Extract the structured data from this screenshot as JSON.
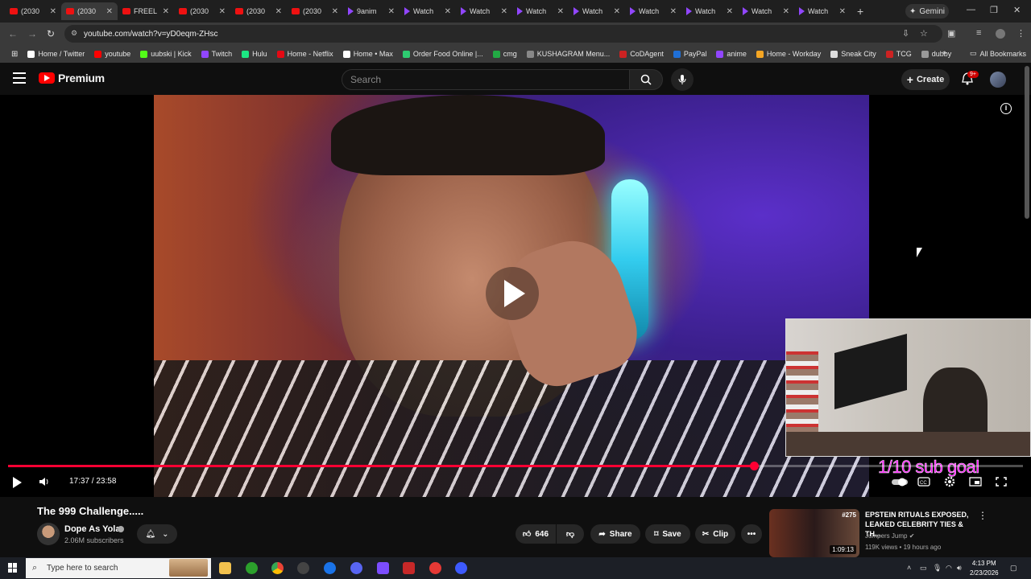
{
  "browser": {
    "tabs": [
      {
        "label": "(2030",
        "icon": "youtube-icon",
        "active": false
      },
      {
        "label": "(2030",
        "icon": "youtube-icon",
        "active": true
      },
      {
        "label": "FREEL",
        "icon": "youtube-icon",
        "active": false
      },
      {
        "label": "(2030",
        "icon": "youtube-icon",
        "active": false
      },
      {
        "label": "(2030",
        "icon": "youtube-icon",
        "active": false
      },
      {
        "label": "(2030",
        "icon": "youtube-icon",
        "active": false
      },
      {
        "label": "9anim",
        "icon": "twitch-icon",
        "active": false
      },
      {
        "label": "Watch",
        "icon": "twitch-icon",
        "active": false
      },
      {
        "label": "Watch",
        "icon": "twitch-icon",
        "active": false
      },
      {
        "label": "Watch",
        "icon": "twitch-icon",
        "active": false
      },
      {
        "label": "Watch",
        "icon": "twitch-icon",
        "active": false
      },
      {
        "label": "Watch",
        "icon": "twitch-icon",
        "active": false
      },
      {
        "label": "Watch",
        "icon": "twitch-icon",
        "active": false
      },
      {
        "label": "Watch",
        "icon": "twitch-icon",
        "active": false
      },
      {
        "label": "Watch",
        "icon": "twitch-icon",
        "active": false
      }
    ],
    "gemini_label": "Gemini",
    "url": "youtube.com/watch?v=yD0eqm-ZHsc",
    "bookmarks": [
      {
        "label": "Home / Twitter",
        "color": "#ffffff"
      },
      {
        "label": "youtube",
        "color": "#ff0000"
      },
      {
        "label": "uubski | Kick",
        "color": "#53fc18"
      },
      {
        "label": "Twitch",
        "color": "#9146ff"
      },
      {
        "label": "Hulu",
        "color": "#1ce783"
      },
      {
        "label": "Home - Netflix",
        "color": "#e50914"
      },
      {
        "label": "Home • Max",
        "color": "#ffffff"
      },
      {
        "label": "Order Food Online |...",
        "color": "#2ecc71"
      },
      {
        "label": "cmg",
        "color": "#22aa44"
      },
      {
        "label": "KUSHAGRAM Menu...",
        "color": "#888888"
      },
      {
        "label": "CoDAgent",
        "color": "#cc2222"
      },
      {
        "label": "PayPal",
        "color": "#1f6fd6"
      },
      {
        "label": "anime",
        "color": "#9146ff"
      },
      {
        "label": "Home - Workday",
        "color": "#f5a623"
      },
      {
        "label": "Sneak City",
        "color": "#dddddd"
      },
      {
        "label": "TCG",
        "color": "#cc2222"
      },
      {
        "label": "dubby",
        "color": "#999999"
      }
    ],
    "all_bookmarks_label": "All Bookmarks"
  },
  "youtube": {
    "logo_text": "Premium",
    "search_placeholder": "Search",
    "create_label": "Create",
    "notif_count": "9+",
    "player": {
      "current_time": "17:37",
      "duration": "23:58",
      "time_text": "17:37 / 23:58",
      "progress_fraction": 0.735,
      "overlay_text": "1/10 sub goal"
    },
    "video": {
      "title": "The 999 Challenge.....",
      "channel": "Dope As Yola",
      "subscribers": "2.06M subscribers",
      "likes": "646",
      "share_label": "Share",
      "save_label": "Save",
      "clip_label": "Clip"
    },
    "recommended": {
      "title": "EPSTEIN RITUALS EXPOSED, LEAKED CELEBRITY TIES & TH...",
      "channel": "Jumpers Jump",
      "meta": "119K views • 19 hours ago",
      "duration": "1:09:13",
      "episode": "#275"
    }
  },
  "taskbar": {
    "search_placeholder": "Type here to search",
    "time": "4:13 PM",
    "date": "2/23/2026"
  },
  "colors": {
    "accent_red": "#ff0033",
    "sub_goal_magenta": "#ff00ff"
  }
}
